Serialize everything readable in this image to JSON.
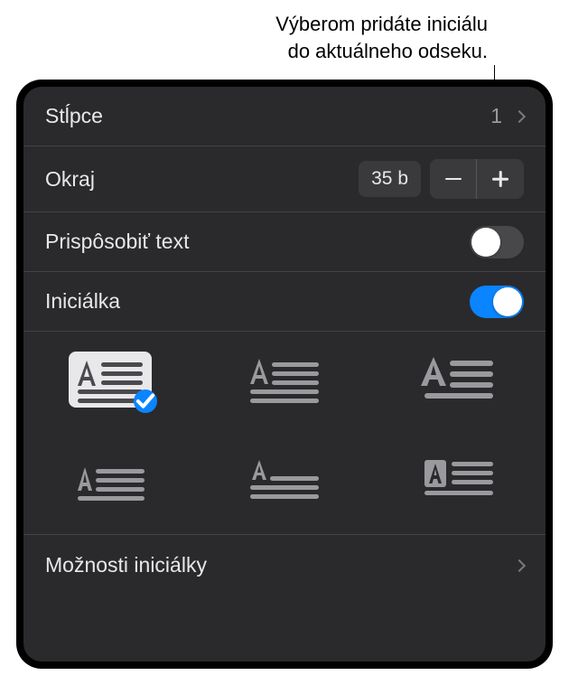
{
  "annotation": {
    "line1": "Výberom pridáte iniciálu",
    "line2": "do aktuálneho odseku."
  },
  "rows": {
    "columns": {
      "label": "Stĺpce",
      "value": "1"
    },
    "margin": {
      "label": "Okraj",
      "value": "35 b"
    },
    "fitText": {
      "label": "Prispôsobiť text",
      "on": false
    },
    "dropCap": {
      "label": "Iniciálka",
      "on": true
    },
    "options": {
      "label": "Možnosti iniciálky"
    }
  },
  "dropCapStyles": {
    "selectedIndex": 0,
    "count": 6
  },
  "colors": {
    "accent": "#0a84ff"
  }
}
